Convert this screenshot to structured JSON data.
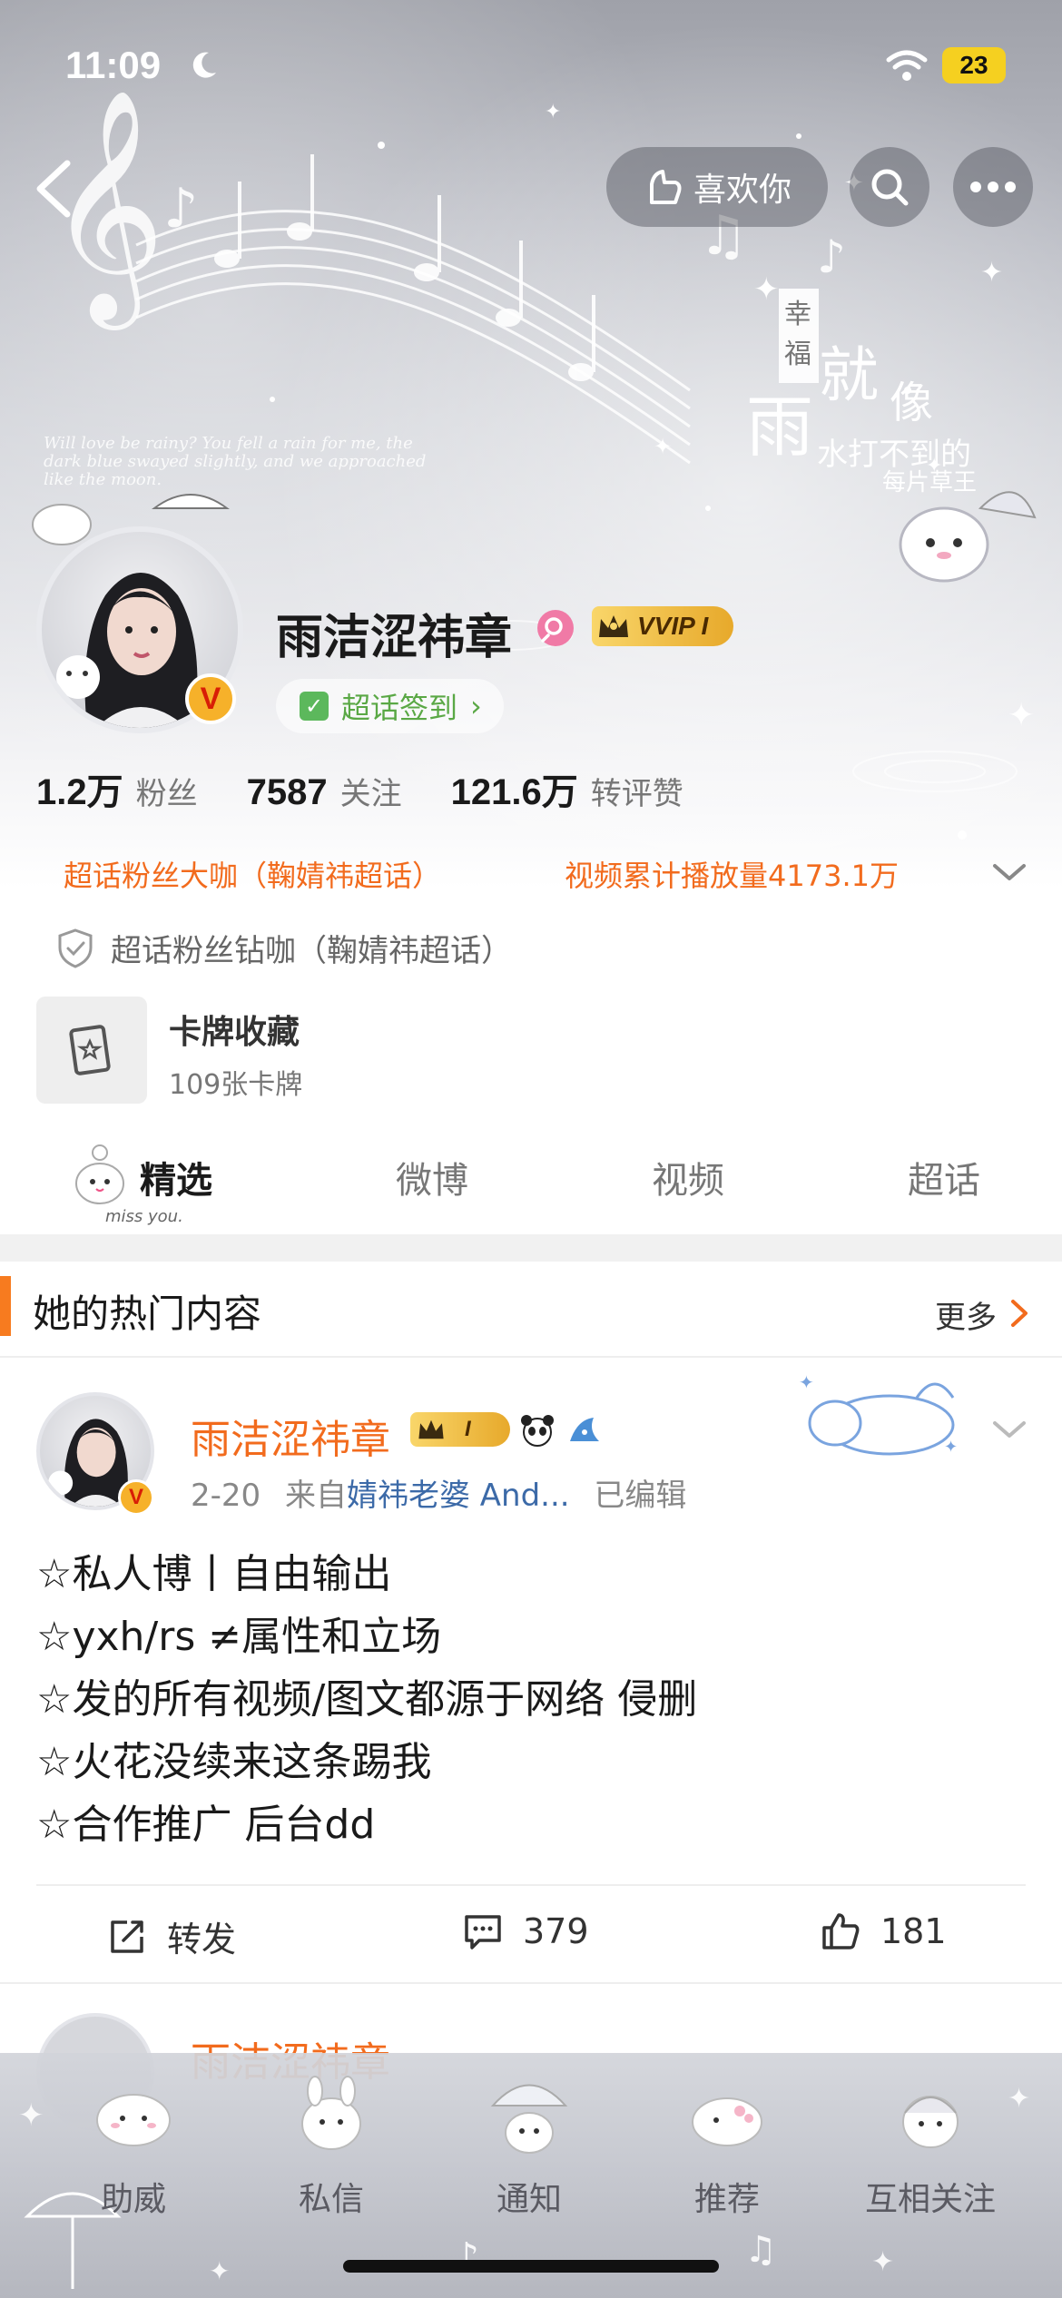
{
  "status_bar": {
    "time": "11:09",
    "battery": "23"
  },
  "header": {
    "like_label": "喜欢你"
  },
  "hero_art": {
    "line1": "Will love be rainy? You fell a rain for me, the",
    "line2": "dark blue swayed slightly, and we approached",
    "line3": "like the moon.",
    "cn_small_1": "幸",
    "cn_small_2": "福",
    "cn_big_1": "雨",
    "cn_big_2": "就",
    "cn_big_3": "像",
    "cn_sub_1": "水打不到的",
    "cn_sub_2": "每片草王"
  },
  "profile": {
    "name": "雨洁涩祎章",
    "vip_label": "VVIP I",
    "verified_mark": "V",
    "checkin_label": "超话签到",
    "checkin_arrow": "›",
    "stats": [
      {
        "num": "1.2万",
        "label": "粉丝"
      },
      {
        "num": "7587",
        "label": "关注"
      },
      {
        "num": "121.6万",
        "label": "转评赞"
      }
    ],
    "honor_1": "超话粉丝大咖（鞠婧祎超话）",
    "honor_2": "视频累计播放量4173.1万",
    "diamond": "超话粉丝钻咖（鞠婧祎超话）",
    "card_title": "卡牌收藏",
    "card_sub": "109张卡牌"
  },
  "tabs": [
    {
      "label": "精选",
      "active": true
    },
    {
      "label": "微博",
      "active": false
    },
    {
      "label": "视频",
      "active": false
    },
    {
      "label": "超话",
      "active": false
    }
  ],
  "tab_sticker_text": "miss you.",
  "hot": {
    "title": "她的热门内容",
    "more": "更多"
  },
  "post": {
    "author": "雨洁涩祎章",
    "vip_label": "I",
    "verified_mark": "V",
    "date": "2-20",
    "from_label": "来自",
    "source": "婧祎老婆 And...",
    "edited": "已编辑",
    "lines": [
      "☆私人博丨自由输出",
      "☆yxh/rs ≠属性和立场",
      "☆发的所有视频/图文都源于网络 侵删",
      "☆火花没续来这条踢我",
      "☆合作推广 后台dd"
    ],
    "repost_label": "转发",
    "comments": "379",
    "likes": "181"
  },
  "peek_post": {
    "author": "雨洁涩祎章"
  },
  "tabbar": [
    {
      "label": "助威"
    },
    {
      "label": "私信"
    },
    {
      "label": "通知"
    },
    {
      "label": "推荐"
    },
    {
      "label": "互相关注"
    }
  ],
  "colors": {
    "accent_orange": "#f26b1d",
    "verified_gold": "#f6b12a",
    "checkin_green": "#5aa845",
    "link_blue": "#3c6aa8"
  },
  "icons": [
    "moon-icon",
    "wifi-icon",
    "back-icon",
    "like-hand-icon",
    "search-icon",
    "more-icon",
    "gender-icon",
    "crown-icon",
    "check-icon",
    "shield-icon",
    "card-icon",
    "chevron-down-icon",
    "chevron-right-icon",
    "repost-icon",
    "comment-icon",
    "thumb-up-icon",
    "panda-icon",
    "shark-icon"
  ]
}
